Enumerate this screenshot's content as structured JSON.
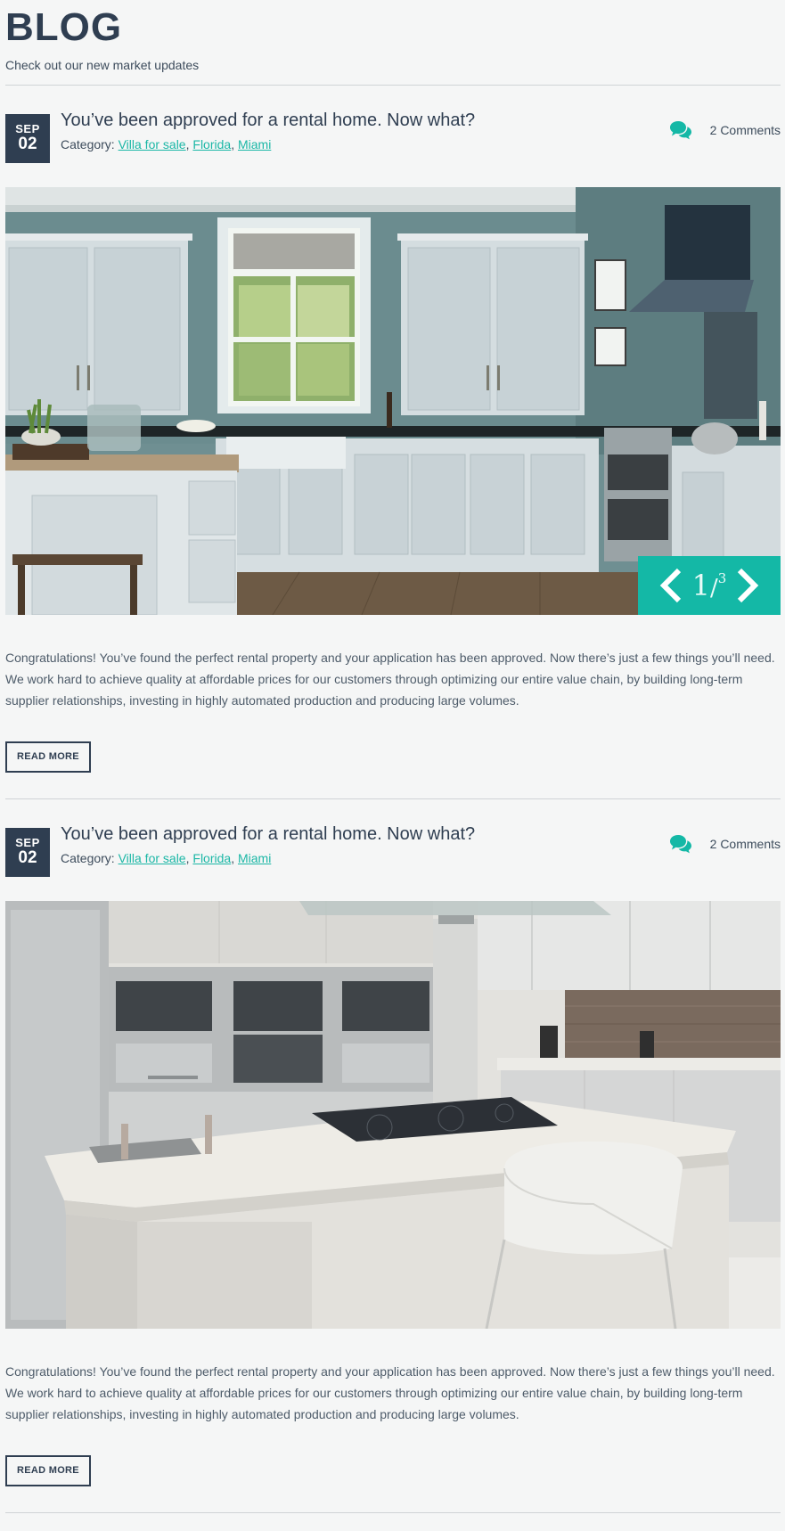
{
  "header": {
    "title": "BLOG",
    "subtitle": "Check out our new market updates"
  },
  "posts": [
    {
      "month": "SEP",
      "day": "02",
      "title": "You’ve been approved for a rental home. Now what?",
      "category_label": "Category:",
      "categories": [
        "Villa for sale",
        "Florida",
        "Miami"
      ],
      "comments": "2 Comments",
      "slider": {
        "current": "1",
        "separator": "/",
        "total": "3"
      },
      "excerpt": "Congratulations! You’ve found the perfect rental property and your application has been approved. Now there’s just a few things you’ll need. We work hard to achieve quality at affordable prices for our customers through optimizing our entire value chain, by building long-term supplier relationships, investing in highly automated production and producing large volumes.",
      "read_more": "READ MORE"
    },
    {
      "month": "SEP",
      "day": "02",
      "title": "You’ve been approved for a rental home. Now what?",
      "category_label": "Category:",
      "categories": [
        "Villa for sale",
        "Florida",
        "Miami"
      ],
      "comments": "2 Comments",
      "excerpt": "Congratulations! You’ve found the perfect rental property and your application has been approved. Now there’s just a few things you’ll need. We work hard to achieve quality at affordable prices for our customers through optimizing our entire value chain, by building long-term supplier relationships, investing in highly automated production and producing large volumes.",
      "read_more": "READ MORE"
    }
  ],
  "icons": {
    "comments": "comments-icon",
    "prev": "chevron-left-icon",
    "next": "chevron-right-icon"
  },
  "colors": {
    "accent": "#14b8a6",
    "link": "#1bb7a6",
    "dark": "#2f3e51",
    "background": "#f5f6f6"
  }
}
